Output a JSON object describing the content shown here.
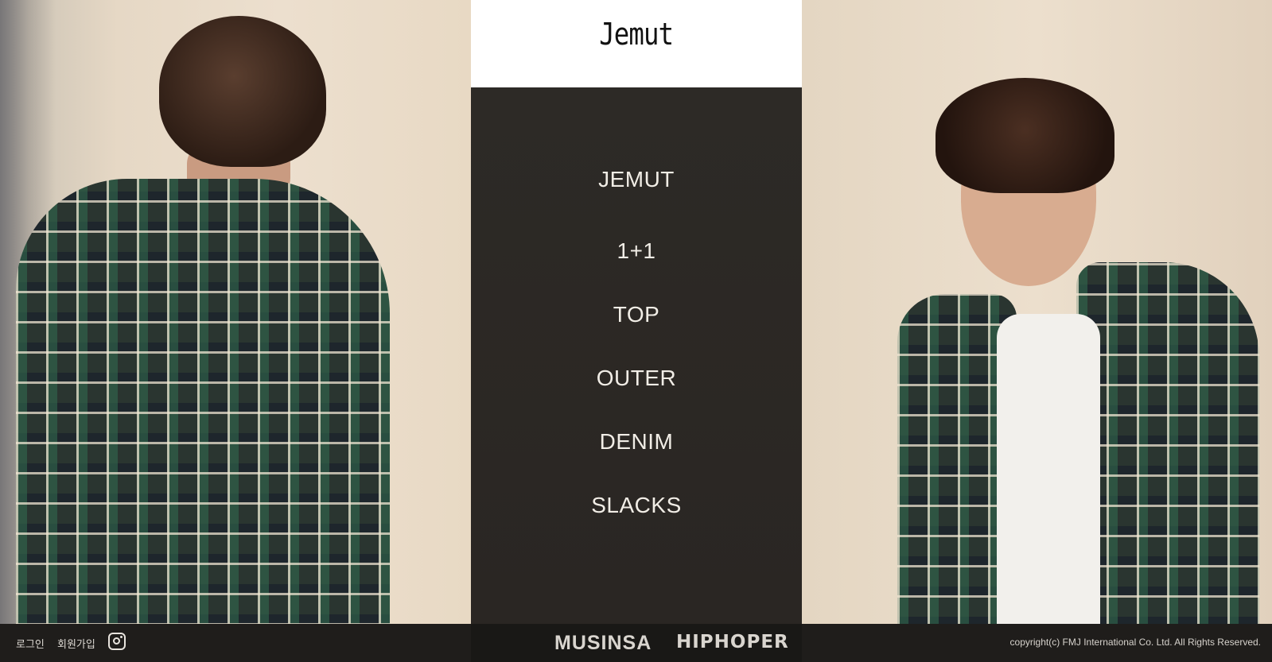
{
  "logo": {
    "text": "Jemut"
  },
  "menu": {
    "items": [
      {
        "label": "JEMUT"
      },
      {
        "label": "1+1"
      },
      {
        "label": "TOP"
      },
      {
        "label": "OUTER"
      },
      {
        "label": "DENIM"
      },
      {
        "label": "SLACKS"
      }
    ]
  },
  "footer": {
    "login_label": "로그인",
    "signup_label": "회원가입",
    "instagram_icon": "instagram-icon",
    "partners": [
      "MUSINSA",
      "HIPHOPER"
    ],
    "copyright": "copyright(c) FMJ International Co. Ltd.  All Rights Reserved."
  },
  "colors": {
    "menu_bg": "#2b2825",
    "menu_text": "#f1ede6",
    "footer_bg": "#1f1d1b",
    "logo_bg": "#ffffff"
  }
}
